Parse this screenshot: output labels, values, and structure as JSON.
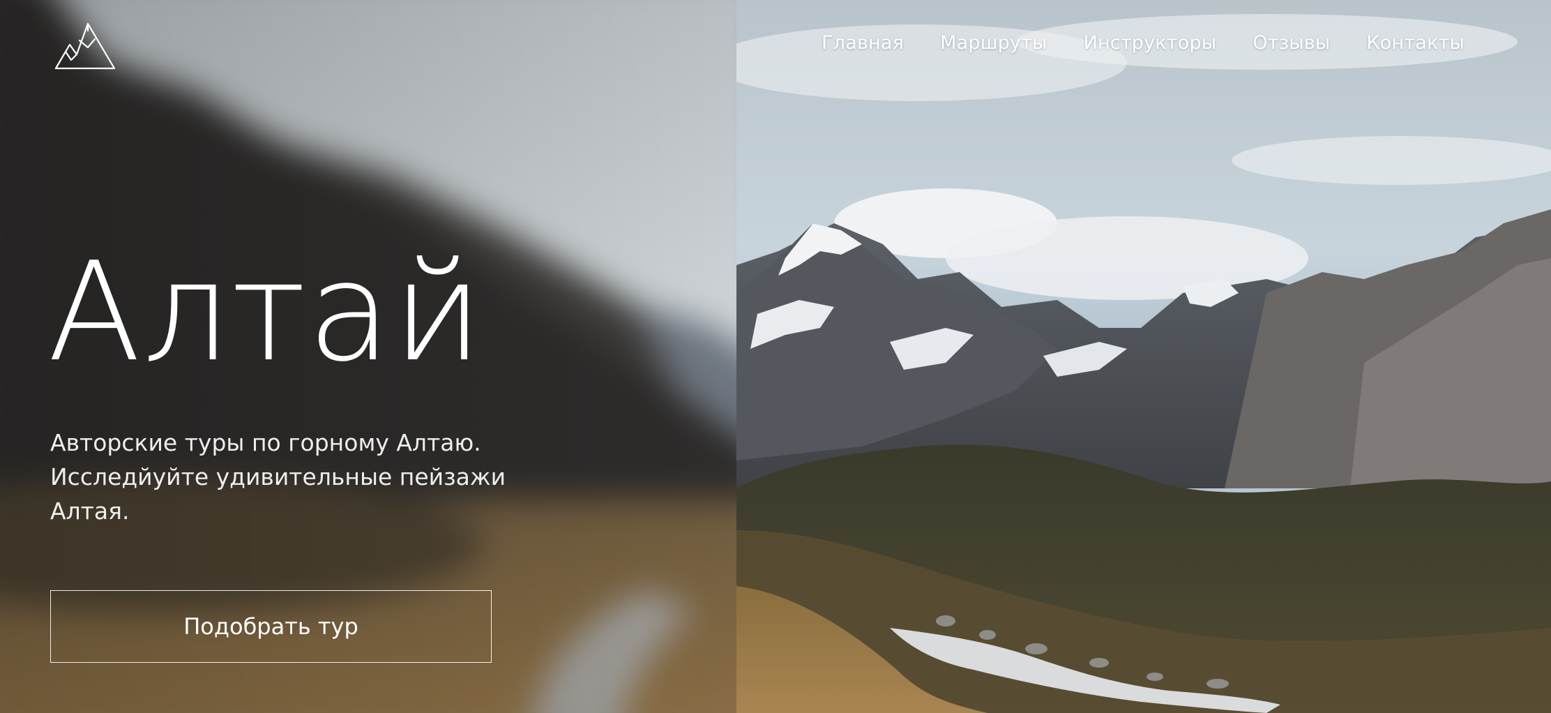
{
  "brand": {
    "logo": "mountains-logo-icon"
  },
  "nav": {
    "items": [
      {
        "label": "Главная"
      },
      {
        "label": "Маршруты"
      },
      {
        "label": "Инструкторы"
      },
      {
        "label": "Отзывы"
      },
      {
        "label": "Контакты"
      }
    ]
  },
  "hero": {
    "title": "Алтай",
    "subtitle": "Авторские туры по горному Алтаю. Исследйуйте удивительные пейзажи Алтая.",
    "cta_label": "Подобрать тур"
  },
  "colors": {
    "text": "#ffffff",
    "sky": "#c9d3da",
    "grass": "#9b7b45",
    "rock": "#4b4d50"
  }
}
